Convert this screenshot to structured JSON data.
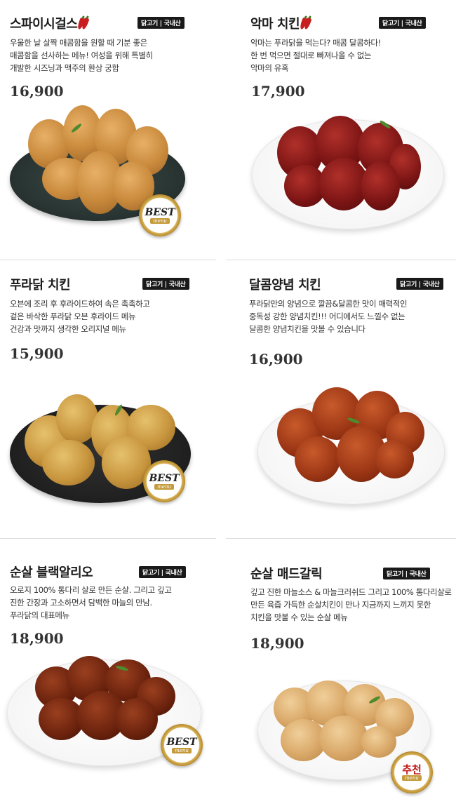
{
  "origin_badge": "닭고기 | 국내산",
  "menu_items": [
    {
      "title": "스파이시걸스",
      "spicy": true,
      "desc": [
        "우울한 날 살짝 매콤함을 원할 때 기분 좋은",
        "매콤함을 선사하는 메뉴! 여성을 위해 특별히",
        "개발한 시즈닝과 맥주의 환상 궁합"
      ],
      "price": "16,900",
      "seal_main": "BEST",
      "seal_sub": "menu"
    },
    {
      "title": "악마 치킨",
      "spicy": true,
      "desc": [
        "악마는 푸라닭을 먹는다? 매콤 달콤하다!",
        "한 번 먹으면 절대로 빠져나올 수 없는",
        "악마의 유혹"
      ],
      "price": "17,900"
    },
    {
      "title": "푸라닭 치킨",
      "desc": [
        "오븐에 조리 후 후라이드하여 속은 촉촉하고",
        "겉은 바삭한 푸라닭 오븐 후라이드 메뉴",
        "건강과 맛까지 생각한 오리지널 메뉴"
      ],
      "price": "15,900",
      "seal_main": "BEST",
      "seal_sub": "menu"
    },
    {
      "title": "달콤양념 치킨",
      "desc": [
        "푸라닭만의 양념으로 깔끔&달콤한 맛이 매력적인",
        "중독성 강한 양념치킨!!! 어디에서도 느낄수 없는",
        "달콤한 양념치킨을 맛볼 수 있습니다"
      ],
      "price": "16,900"
    },
    {
      "title": "순살 블랙알리오",
      "desc": [
        "오로지 100% 통다리 살로 만든 순살. 그리고 깊고",
        "진한 간장과 고소하면서 담백한 마늘의 만남.",
        "푸라닭의 대표메뉴"
      ],
      "price": "18,900",
      "seal_main": "BEST",
      "seal_sub": "menu"
    },
    {
      "title": "순살 매드갈릭",
      "desc": [
        "깊고 진한 마늘소스 & 마늘크러쉬드 그리고 100% 통다리살로",
        "만든 육즙 가득한 순살치킨이 만나 지금까지 느끼지 못한",
        "치킨을 맛볼 수 있는 순살 메뉴"
      ],
      "price": "18,900",
      "seal_main": "추천",
      "seal_sub": "menu"
    }
  ]
}
